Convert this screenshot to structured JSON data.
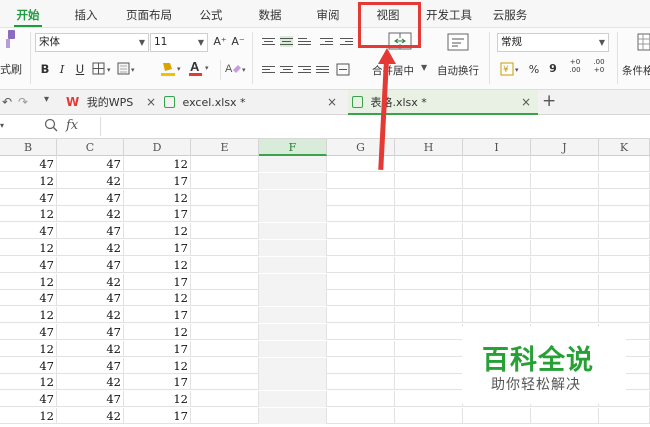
{
  "menu": {
    "tabs": [
      "开始",
      "插入",
      "页面布局",
      "公式",
      "数据",
      "审阅",
      "视图",
      "开发工具",
      "云服务"
    ]
  },
  "ribbon": {
    "format_painter_label": "式刷",
    "font_name": "宋体",
    "font_size": "11",
    "grow_font": "A⁺",
    "shrink_font": "A⁻",
    "bold": "B",
    "italic": "I",
    "underline": "U",
    "merge_center_label": "合并居中",
    "wrap_text_label": "自动换行",
    "number_format": "常规",
    "percent": "%",
    "thousands": "9",
    "inc_decimal": "+0 .00",
    "dec_decimal": ".00 +0",
    "cond_format_label": "条件格"
  },
  "doc_tabs": [
    {
      "label": "我的WPS",
      "brand": "W"
    },
    {
      "label": "excel.xlsx *"
    },
    {
      "label": "表格.xlsx *"
    }
  ],
  "formula_bar": {
    "name_box": "",
    "fx": "fx",
    "value": ""
  },
  "grid": {
    "columns": [
      "B",
      "C",
      "D",
      "E",
      "F",
      "G",
      "H",
      "I",
      "J",
      "K"
    ],
    "selected_column": "F",
    "rows": [
      [
        "47",
        "47",
        "12"
      ],
      [
        "12",
        "42",
        "17"
      ],
      [
        "47",
        "47",
        "12"
      ],
      [
        "12",
        "42",
        "17"
      ],
      [
        "47",
        "47",
        "12"
      ],
      [
        "12",
        "42",
        "17"
      ],
      [
        "47",
        "47",
        "12"
      ],
      [
        "12",
        "42",
        "17"
      ],
      [
        "47",
        "47",
        "12"
      ],
      [
        "12",
        "42",
        "17"
      ],
      [
        "47",
        "47",
        "12"
      ],
      [
        "12",
        "42",
        "17"
      ],
      [
        "47",
        "47",
        "12"
      ],
      [
        "12",
        "42",
        "17"
      ],
      [
        "47",
        "47",
        "12"
      ],
      [
        "12",
        "42",
        "17"
      ]
    ]
  },
  "watermark": {
    "title": "百科全说",
    "subtitle": "助你轻松解决"
  },
  "colors": {
    "accent_green": "#1f9b3f",
    "highlight_red": "#e53935"
  }
}
